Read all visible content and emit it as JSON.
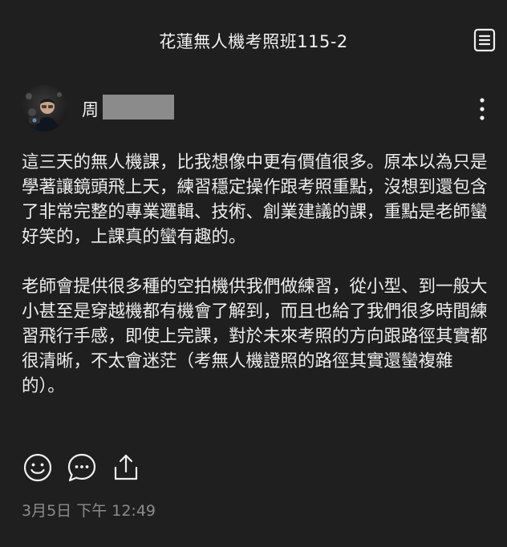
{
  "header": {
    "title": "花蓮無人機考照班115-2",
    "menu_icon": "list-icon"
  },
  "author": {
    "name_initial": "周",
    "avatar_icon": "profile-photo",
    "more_icon": "vertical-dots-icon"
  },
  "post": {
    "paragraphs": [
      "這三天的無人機課，比我想像中更有價值很多。原本以為只是學著讓鏡頭飛上天，練習穩定操作跟考照重點，沒想到還包含了非常完整的專業邏輯、技術、創業建議的課，重點是老師蠻好笑的，上課真的蠻有趣的。",
      "老師會提供很多種的空拍機供我們做練習，從小型、到一般大小甚至是穿越機都有機會了解到，而且也給了我們很多時間練習飛行手感，即使上完課，對於未來考照的方向跟路徑其實都很清晰，不太會迷茫（考無人機證照的路徑其實還蠻複雜的）。"
    ],
    "timestamp": "3月5日 下午 12:49"
  },
  "actions": [
    {
      "icon": "smile-icon"
    },
    {
      "icon": "comment-icon"
    },
    {
      "icon": "share-icon"
    }
  ],
  "colors": {
    "background": "#1f1f1f",
    "text": "#ececec",
    "muted": "#8c8c8c",
    "mask": "#8b8b8b"
  }
}
